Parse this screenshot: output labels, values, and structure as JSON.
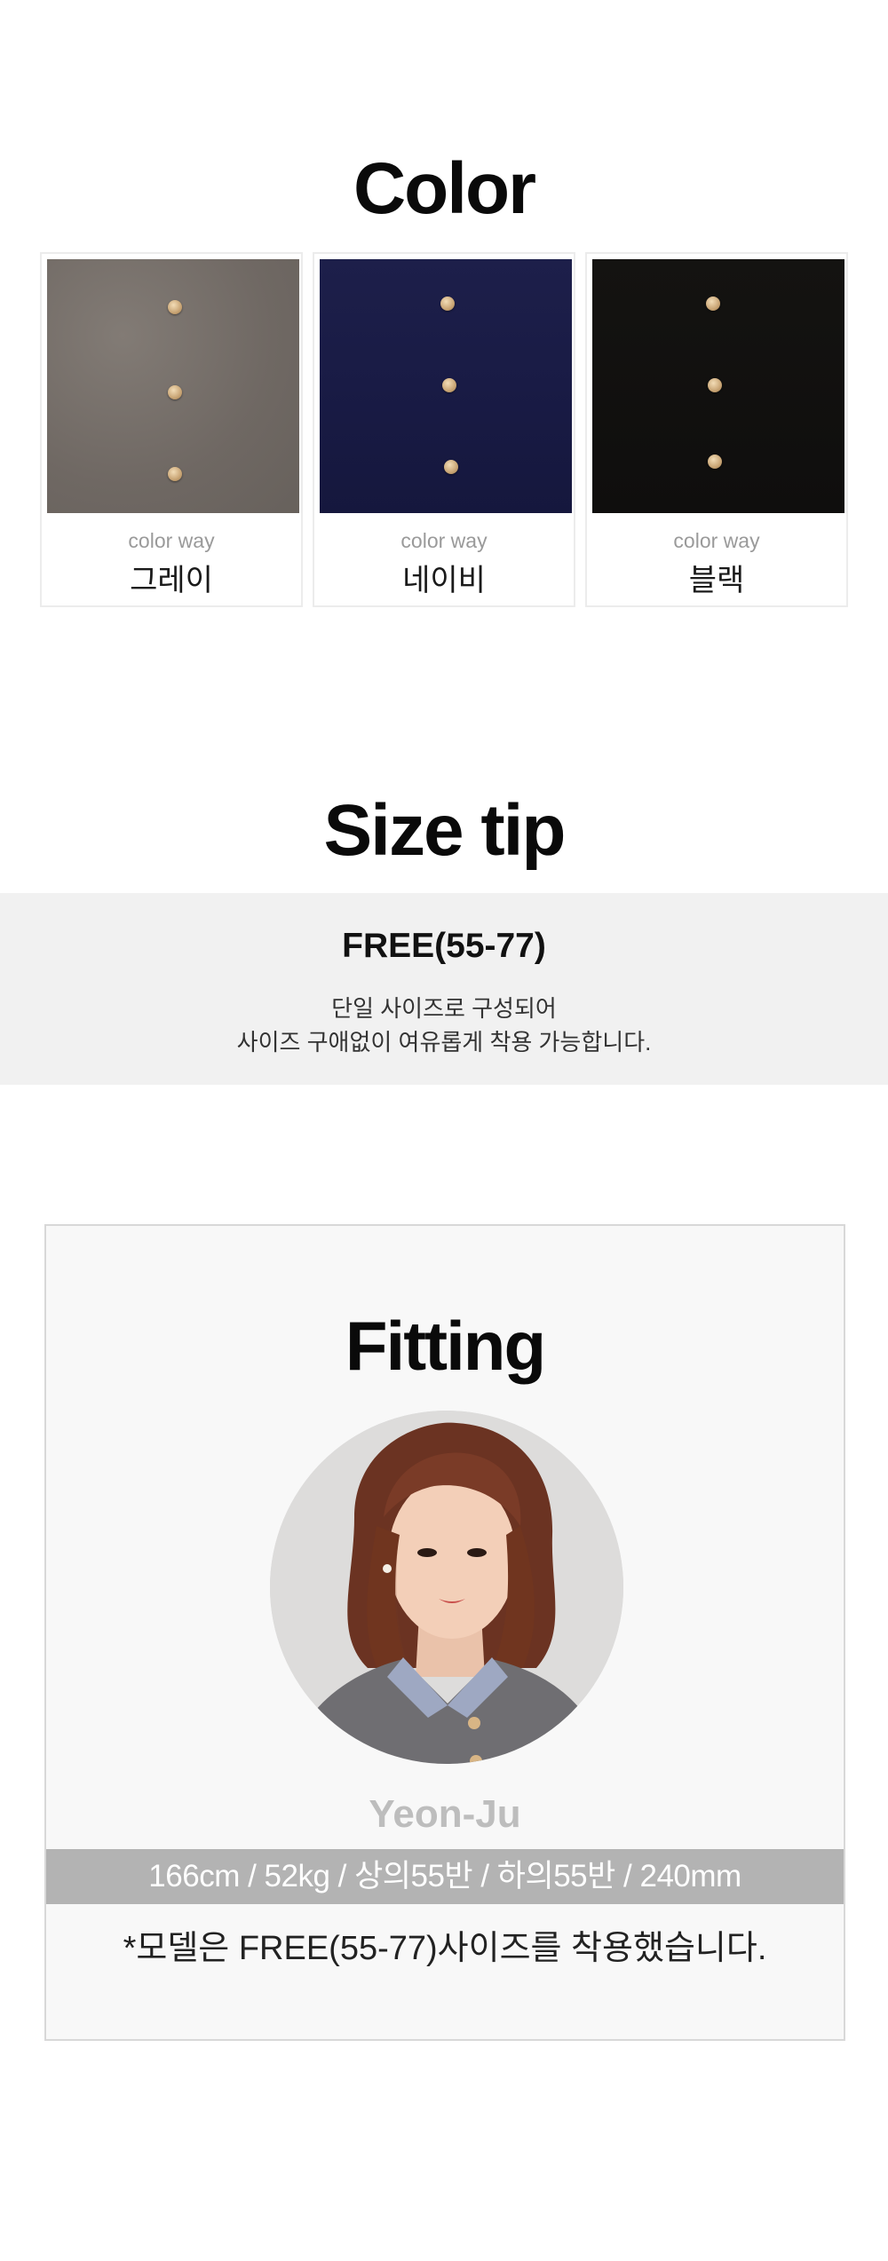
{
  "color_section": {
    "title": "Color",
    "swatches": [
      {
        "caption_small": "color way",
        "name": "그레이",
        "fabric_color": "#6f6863"
      },
      {
        "caption_small": "color way",
        "name": "네이비",
        "fabric_color": "#1b1d47"
      },
      {
        "caption_small": "color way",
        "name": "블랙",
        "fabric_color": "#121110"
      }
    ]
  },
  "size_section": {
    "title": "Size tip",
    "size_name": "FREE(55-77)",
    "lines": [
      "단일 사이즈로 구성되어",
      "사이즈 구애없이 여유롭게 착용 가능합니다."
    ]
  },
  "fitting_section": {
    "title": "Fitting",
    "model_name": "Yeon-Ju",
    "model_stats": "166cm / 52kg / 상의55반 / 하의55반 / 240mm",
    "note": "*모델은 FREE(55-77)사이즈를 착용했습니다."
  }
}
